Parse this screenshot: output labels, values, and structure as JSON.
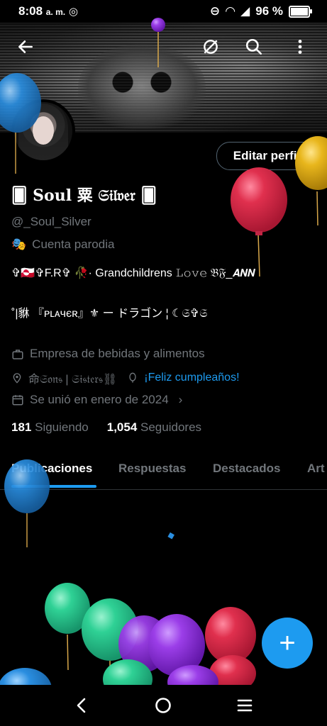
{
  "status_bar": {
    "time": "8:08",
    "ampm": "a. m.",
    "battery": "96 %",
    "battery_level": 0.96
  },
  "header": {
    "back_icon": "arrow-left-icon",
    "sync_icon": "circle-slash-icon",
    "search_icon": "search-icon",
    "more_icon": "more-vertical-icon"
  },
  "profile": {
    "edit_button": "Editar perfil",
    "display_name": "🂠 𝐒𝐨𝐮𝐥 粟 𝔖𝔦𝔩𝔳𝔢𝔯 🂠",
    "handle": "@_Soul_Silver",
    "parody_label": "Cuenta parodia",
    "bio_line1": "✞🇬🇱✞F.R✞ 🥀·  Grandchildrens 𝙻𝚘𝚟𝚎 𝔅𝔉_𝘼𝙉𝙉",
    "bio_line2": "˚|貅 『ᴘʟᴀчєʀ』⚜ ー ドラゴン ¦ ☾𝔖✞𝔖",
    "category": "Empresa de bebidas y alimentos",
    "location": "命𝔖𝔬𝔫𝔰 | 𝔖𝔦𝔰𝔱𝔢𝔯𝔰⛓",
    "birthday": "¡Feliz cumpleaños!",
    "joined": "Se unió en enero de 2024",
    "following_count": "181",
    "following_label": "Siguiendo",
    "followers_count": "1,054",
    "followers_label": "Seguidores"
  },
  "tabs": [
    {
      "label": "Publicaciones",
      "active": true
    },
    {
      "label": "Respuestas",
      "active": false
    },
    {
      "label": "Destacados",
      "active": false
    },
    {
      "label": "Art",
      "active": false
    }
  ],
  "fab": {
    "label": "+"
  },
  "colors": {
    "accent": "#1d9bf0",
    "secondary_text": "#71767b",
    "balloon_red": "#e0304e",
    "balloon_green": "#2fd195",
    "balloon_purple": "#9b3ee8",
    "balloon_blue": "#2a8ee0",
    "balloon_yellow": "#e8b61c"
  }
}
